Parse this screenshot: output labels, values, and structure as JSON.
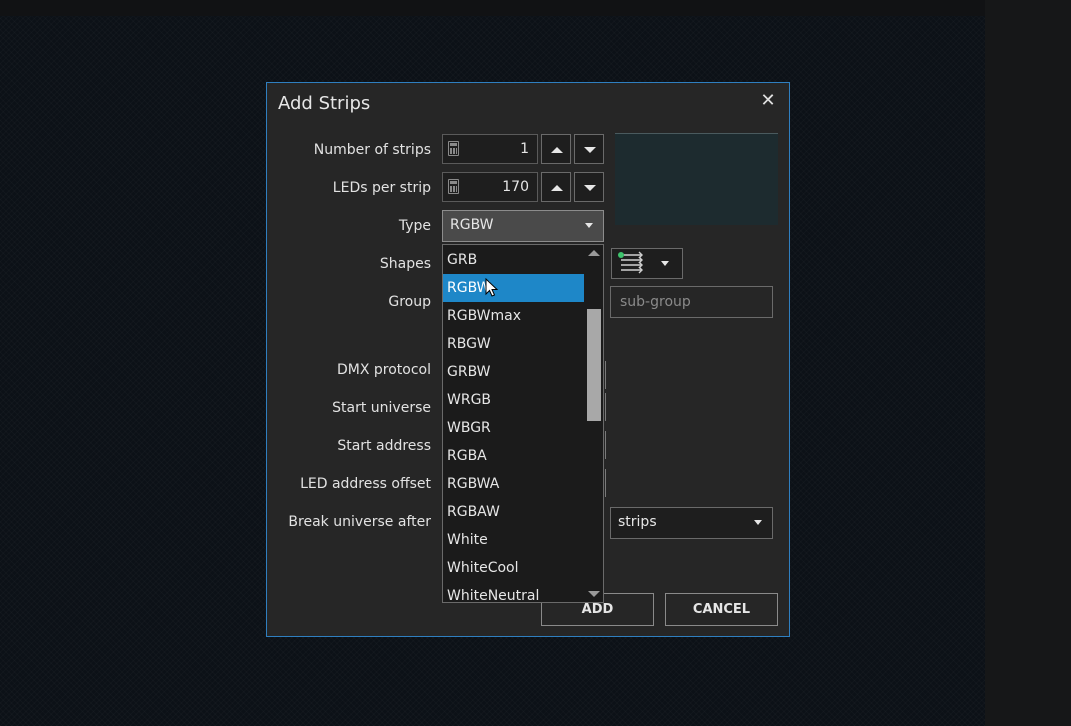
{
  "dialog": {
    "title": "Add Strips",
    "close_glyph": "✕"
  },
  "fields": {
    "number_of_strips": {
      "label": "Number of strips",
      "value": "1"
    },
    "leds_per_strip": {
      "label": "LEDs per strip",
      "value": "170"
    },
    "type": {
      "label": "Type",
      "value": "RGBW"
    },
    "shapes": {
      "label": "Shapes",
      "icon": "strip-arrows-icon"
    },
    "group": {
      "label": "Group",
      "subgroup_placeholder": "sub-group"
    },
    "dmx_protocol": {
      "label": "DMX protocol"
    },
    "start_universe": {
      "label": "Start universe"
    },
    "start_address": {
      "label": "Start address"
    },
    "led_address_offset": {
      "label": "LED address offset"
    },
    "break_universe_after": {
      "label": "Break universe after",
      "unit_value": "strips"
    }
  },
  "type_dropdown": {
    "selected_index": 1,
    "options": [
      "GRB",
      "RGBW",
      "RGBWmax",
      "RBGW",
      "GRBW",
      "WRGB",
      "WBGR",
      "RGBA",
      "RGBWA",
      "RGBAW",
      "White",
      "WhiteCool",
      "WhiteNeutral"
    ]
  },
  "buttons": {
    "add": "ADD",
    "cancel": "CANCEL"
  },
  "colors": {
    "accent": "#1e87c8",
    "dialog_border": "#2f7fc0",
    "shape_dot": "#3ec46d"
  }
}
